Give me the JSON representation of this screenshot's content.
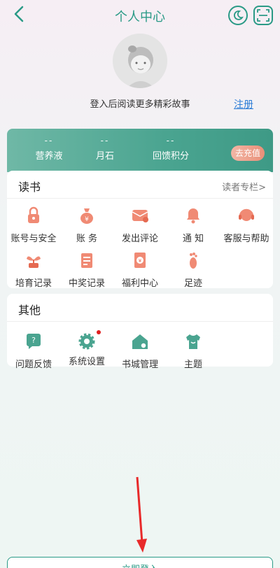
{
  "header": {
    "title": "个人中心"
  },
  "profile": {
    "login_prompt": "登入后阅读更多精彩故事",
    "register_label": "注册"
  },
  "stats": [
    {
      "value": "--",
      "label": "营养液"
    },
    {
      "value": "--",
      "label": "月石"
    },
    {
      "value": "--",
      "label": "回馈积分"
    }
  ],
  "recharge_label": "去充值",
  "reading": {
    "title": "读书",
    "more_label": "读者专栏>",
    "items": [
      {
        "label": "账号与安全",
        "icon": "lock-icon"
      },
      {
        "label": "账 务",
        "icon": "money-bag-icon"
      },
      {
        "label": "发出评论",
        "icon": "comment-envelope-icon"
      },
      {
        "label": "通 知",
        "icon": "bell-icon"
      },
      {
        "label": "客服与帮助",
        "icon": "headset-icon"
      },
      {
        "label": "培育记录",
        "icon": "sprout-icon"
      },
      {
        "label": "中奖记录",
        "icon": "notepad-icon"
      },
      {
        "label": "福利中心",
        "icon": "red-envelope-icon"
      },
      {
        "label": "足迹",
        "icon": "footprint-icon"
      }
    ]
  },
  "other": {
    "title": "其他",
    "items": [
      {
        "label": "问题反馈",
        "icon": "question-bubble-icon"
      },
      {
        "label": "系统设置",
        "icon": "gear-icon"
      },
      {
        "label": "书城管理",
        "icon": "home-gear-icon"
      },
      {
        "label": "主题",
        "icon": "shirt-icon"
      }
    ]
  },
  "bottom_button": "立即登入",
  "colors": {
    "accent": "#2a9a86",
    "link": "#2a7bd6"
  }
}
